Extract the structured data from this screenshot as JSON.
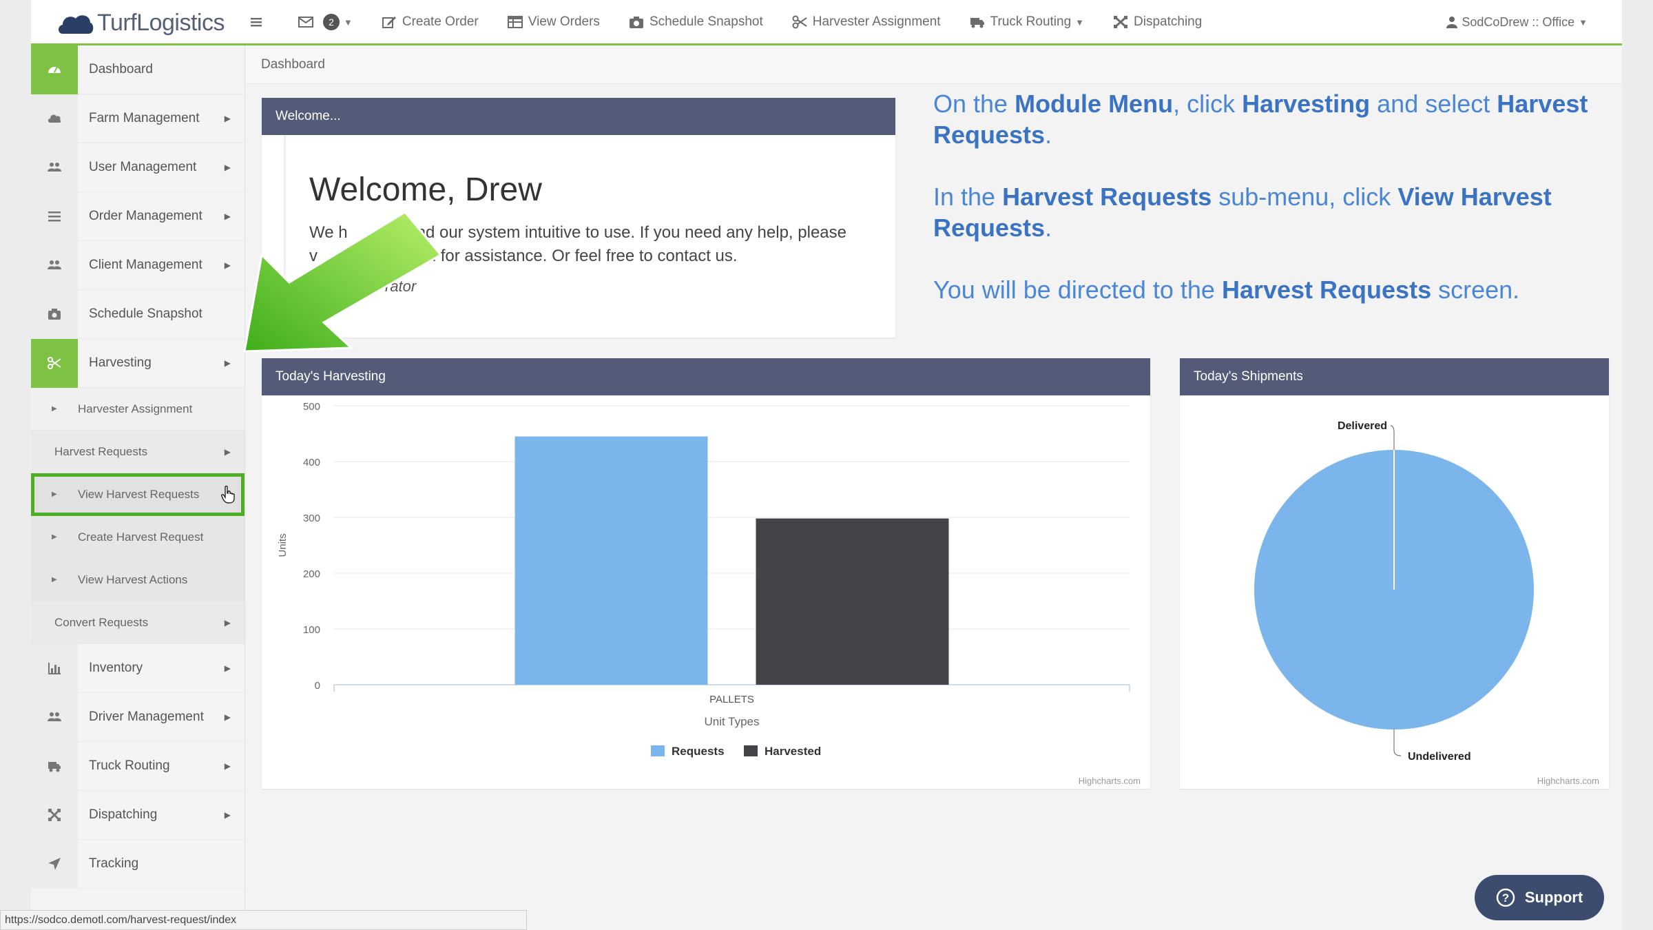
{
  "app": {
    "logo_text": "TurfLogistics"
  },
  "topnav": {
    "mail_count": "2",
    "items": [
      "Create Order",
      "View Orders",
      "Schedule Snapshot",
      "Harvester Assignment",
      "Truck Routing",
      "Dispatching"
    ],
    "user": "SodCoDrew :: Office"
  },
  "sidebar": {
    "items": [
      {
        "label": "Dashboard",
        "icon": "dashboard-icon"
      },
      {
        "label": "Farm Management",
        "icon": "cloud-icon"
      },
      {
        "label": "User Management",
        "icon": "users-icon"
      },
      {
        "label": "Order Management",
        "icon": "list-icon"
      },
      {
        "label": "Client Management",
        "icon": "users-icon"
      },
      {
        "label": "Schedule Snapshot",
        "icon": "camera-icon"
      },
      {
        "label": "Harvesting",
        "icon": "scissors-icon"
      }
    ],
    "harvesting_sub": {
      "harvester_assignment": "Harvester Assignment",
      "harvest_requests": "Harvest Requests",
      "view_harvest_requests": "View Harvest Requests",
      "create_harvest_request": "Create Harvest Request",
      "view_harvest_actions": "View Harvest Actions",
      "convert_requests": "Convert Requests"
    },
    "items_after": [
      {
        "label": "Inventory",
        "icon": "bar-chart-icon"
      },
      {
        "label": "Driver Management",
        "icon": "users-icon"
      },
      {
        "label": "Truck Routing",
        "icon": "truck-icon"
      },
      {
        "label": "Dispatching",
        "icon": "dispatch-icon"
      },
      {
        "label": "Tracking",
        "icon": "location-arrow-icon"
      }
    ]
  },
  "breadcrumb": "Dashboard",
  "welcome": {
    "header": "Welcome...",
    "title": "Welcome, Drew",
    "line1_a": "We h",
    "line1_b": "u find our system intuitive to use. If you need any help, please",
    "line2_a": "v",
    "line2_b": "section for assistance. Or feel free to contact us.",
    "sign": "rator"
  },
  "instructions": {
    "p1_a": "On the ",
    "p1_b": "Module Menu",
    "p1_c": ", click ",
    "p1_d": "Harvesting",
    "p1_e": " and select ",
    "p1_f": "Harvest Requests",
    "p1_g": ".",
    "p2_a": "In the ",
    "p2_b": "Harvest Requests",
    "p2_c": " sub-menu, click ",
    "p2_d": "View Harvest Requests",
    "p2_e": ".",
    "p3_a": "You will be directed to the ",
    "p3_b": "Harvest Requests",
    "p3_c": " screen."
  },
  "harvest_panel": {
    "header": "Today's Harvesting",
    "credit": "Highcharts.com"
  },
  "ship_panel": {
    "header": "Today's Shipments",
    "credit": "Highcharts.com"
  },
  "chart_data": [
    {
      "type": "bar",
      "categories": [
        "PALLETS"
      ],
      "series": [
        {
          "name": "Requests",
          "values": [
            445
          ],
          "color": "#7cb5ec"
        },
        {
          "name": "Harvested",
          "values": [
            298
          ],
          "color": "#434348"
        }
      ],
      "xlabel": "Unit Types",
      "ylabel": "Units",
      "ylim": [
        0,
        500
      ],
      "yticks": [
        0,
        100,
        200,
        300,
        400,
        500
      ],
      "legend": "bottom-center",
      "grid": true
    },
    {
      "type": "pie",
      "slices": [
        {
          "label": "Delivered",
          "value": 0
        },
        {
          "label": "Undelivered",
          "value": 100
        }
      ],
      "color": "#7cb5ec"
    }
  ],
  "statusbar": "https://sodco.demotl.com/harvest-request/index",
  "support": "Support"
}
